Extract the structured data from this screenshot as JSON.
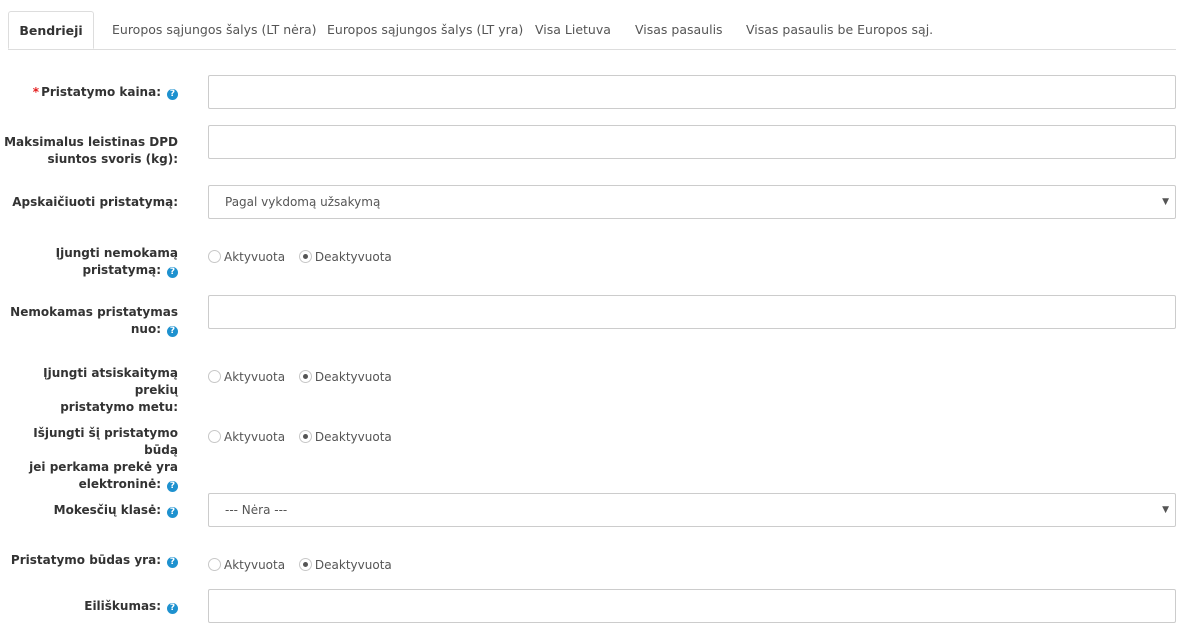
{
  "tabs": [
    {
      "label": "Bendrieji",
      "active": true
    },
    {
      "label": "Europos sąjungos šalys (LT nėra)",
      "active": false
    },
    {
      "label": "Europos sąjungos šalys (LT yra)",
      "active": false
    },
    {
      "label": "Visa Lietuva",
      "active": false
    },
    {
      "label": "Visas pasaulis",
      "active": false
    },
    {
      "label": "Visas pasaulis be Europos sąj.",
      "active": false
    }
  ],
  "form": {
    "delivery_price": {
      "label": "Pristatymo kaina:",
      "required_mark": "*",
      "help": "?",
      "value": ""
    },
    "max_weight": {
      "label_line1": "Maksimalus leistinas DPD",
      "label_line2": "siuntos svoris (kg):",
      "value": ""
    },
    "calc_delivery": {
      "label": "Apskaičiuoti pristatymą:",
      "selected": "Pagal vykdomą užsakymą",
      "caret": "▼"
    },
    "free_delivery": {
      "label_line1": "Įjungti nemokamą",
      "label_line2": "pristatymą:",
      "help": "?",
      "option_on": "Aktyvuota",
      "option_off": "Deaktyvuota",
      "selected": "off"
    },
    "free_from": {
      "label_line1": "Nemokamas pristatymas",
      "label_line2": "nuo:",
      "help": "?",
      "value": ""
    },
    "pay_on_delivery": {
      "label_line1": "Įjungti atsiskaitymą prekių",
      "label_line2": "pristatymo metu:",
      "option_on": "Aktyvuota",
      "option_off": "Deaktyvuota",
      "selected": "off"
    },
    "disable_electronic": {
      "label_line1": "Išjungti šį pristatymo būdą",
      "label_line2": "jei perkama prekė yra",
      "label_line3": "elektroninė:",
      "help": "?",
      "option_on": "Aktyvuota",
      "option_off": "Deaktyvuota",
      "selected": "off"
    },
    "tax_class": {
      "label": "Mokesčių klasė:",
      "help": "?",
      "selected": "--- Nėra ---",
      "caret": "▼"
    },
    "status": {
      "label": "Pristatymo būdas yra:",
      "help": "?",
      "option_on": "Aktyvuota",
      "option_off": "Deaktyvuota",
      "selected": "off"
    },
    "sort_order": {
      "label": "Eiliškumas:",
      "help": "?",
      "value": ""
    }
  }
}
